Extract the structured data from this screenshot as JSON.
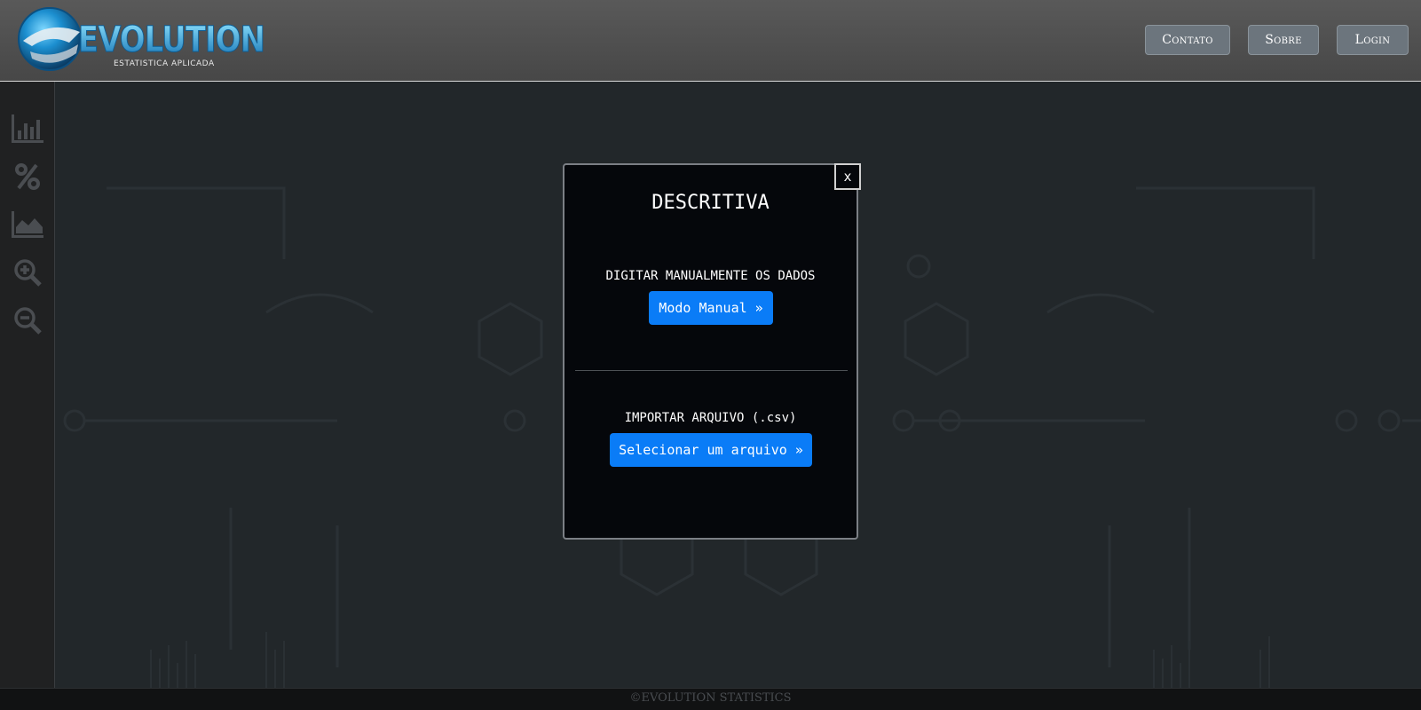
{
  "header": {
    "logo_text": "EVOLUTION",
    "logo_tagline": "ESTATISTICA APLICADA",
    "nav": {
      "contato": "Contato",
      "sobre": "Sobre",
      "login": "Login"
    }
  },
  "sidebar": {
    "icons": [
      "bar-chart-icon",
      "percent-icon",
      "area-chart-icon",
      "zoom-in-icon",
      "zoom-out-icon"
    ]
  },
  "modal": {
    "close_label": "x",
    "title": "DESCRITIVA",
    "manual_label": "DIGITAR MANUALMENTE OS DADOS",
    "manual_button": "Modo Manual »",
    "import_label": "IMPORTAR ARQUIVO (.csv)",
    "import_button": "Selecionar um arquivo »"
  },
  "footer": {
    "text": "©EVOLUTION STATISTICS"
  },
  "colors": {
    "primary_button": "#0a7cf7",
    "nav_button": "#6c757d",
    "modal_bg": "#05070b",
    "logo_accent": "#1fa3d6"
  }
}
